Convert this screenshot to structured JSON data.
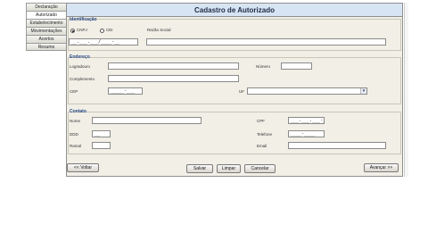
{
  "nav": {
    "items": [
      {
        "label": "Declaração",
        "active": false
      },
      {
        "label": "Autorizado",
        "active": true
      },
      {
        "label": "Estabelecimento",
        "active": false
      },
      {
        "label": "Movimentações",
        "active": false
      },
      {
        "label": "Acertos",
        "active": false
      },
      {
        "label": "Resumo",
        "active": false
      }
    ]
  },
  "title": "Cadastro de Autorizado",
  "identificacao": {
    "section_label": "Identificação",
    "option_cnpj": "CNPJ",
    "option_cei": "CEI",
    "razao_label": "Razão Social",
    "cnpj_mask": "__.___.___/____-__"
  },
  "endereco": {
    "section_label": "Endereço",
    "logradouro_label": "Logradouro",
    "numero_label": "Número",
    "complemento_label": "Complemento",
    "cep_label": "CEP",
    "cep_mask": "_____-___",
    "uf_label": "UF"
  },
  "contato": {
    "section_label": "Contato",
    "nome_label": "Nome",
    "cpf_label": "CPF",
    "cpf_mask": "___.___.___-__",
    "ddd_label": "DDD",
    "ddd_mask": "__",
    "telefone_label": "Telefone",
    "telefone_mask": "____-____",
    "ramal_label": "Ramal",
    "email_label": "Email"
  },
  "buttons": {
    "voltar": "<< Voltar",
    "salvar": "Salvar",
    "limpar": "Limpar",
    "cancelar": "Cancelar",
    "avancar": "Avançar >>"
  }
}
